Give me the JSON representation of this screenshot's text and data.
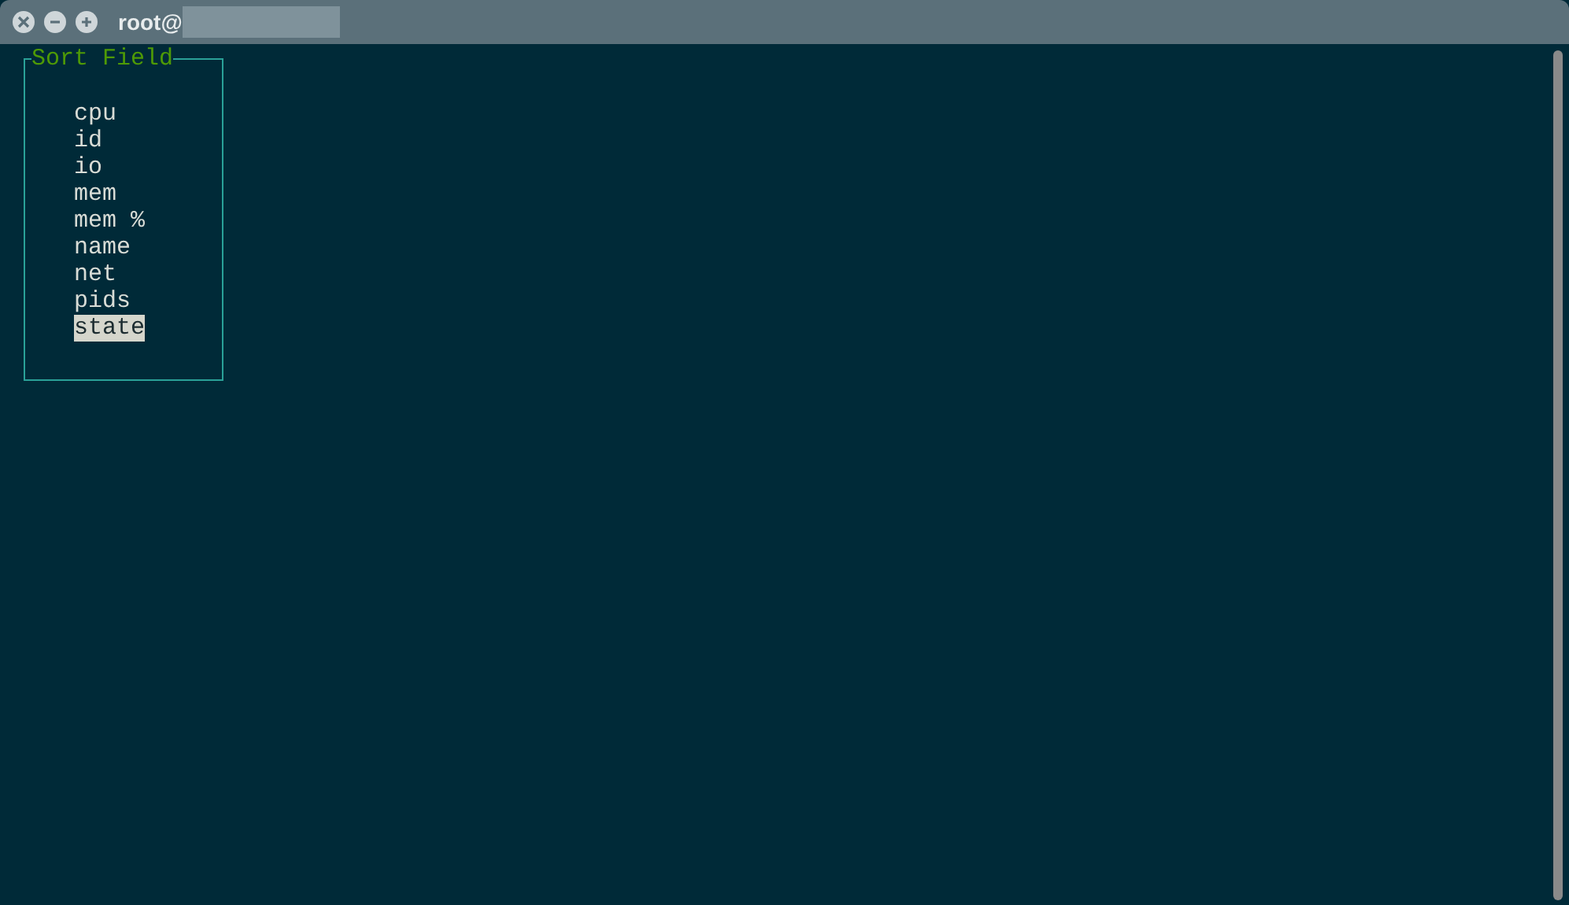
{
  "window": {
    "title": "root@"
  },
  "sort_field": {
    "title": "Sort Field",
    "items": [
      {
        "label": "cpu",
        "selected": false
      },
      {
        "label": "id",
        "selected": false
      },
      {
        "label": "io",
        "selected": false
      },
      {
        "label": "mem",
        "selected": false
      },
      {
        "label": "mem %",
        "selected": false
      },
      {
        "label": "name",
        "selected": false
      },
      {
        "label": "net",
        "selected": false
      },
      {
        "label": "pids",
        "selected": false
      },
      {
        "label": "state",
        "selected": true
      }
    ]
  }
}
